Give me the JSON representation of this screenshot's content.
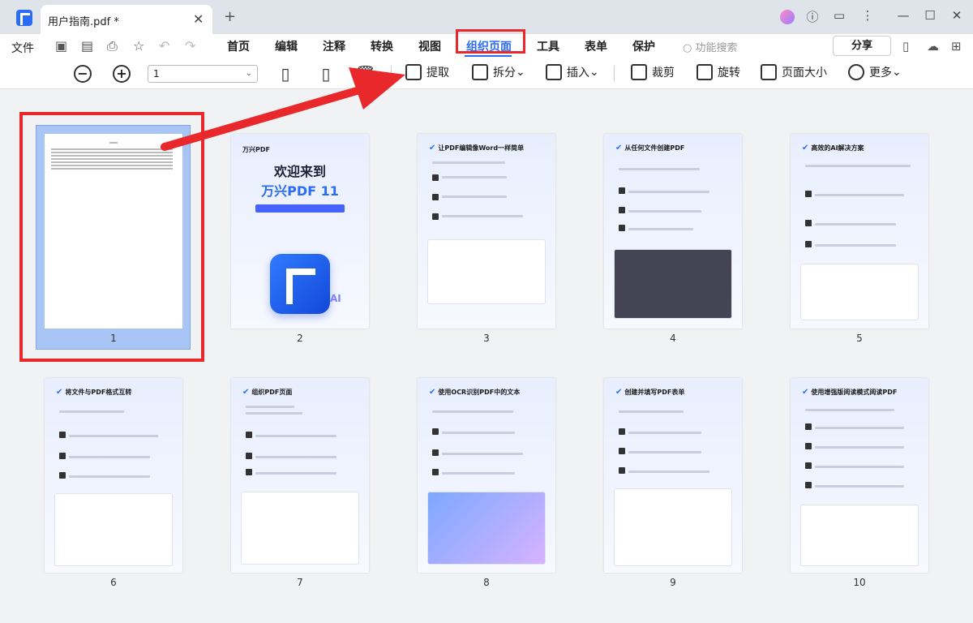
{
  "titlebar": {
    "tab_title": "用户指南.pdf *",
    "close_glyph": "✕",
    "new_tab_glyph": "+"
  },
  "menubar": {
    "file": "文件",
    "items": [
      "首页",
      "编辑",
      "注释",
      "转换",
      "视图",
      "组织页面",
      "工具",
      "表单",
      "保护"
    ],
    "active_index": 5,
    "search_placeholder": "功能搜索",
    "share": "分享"
  },
  "toolbar": {
    "page_value": "1",
    "buttons": {
      "extract": "提取",
      "split": "拆分",
      "insert": "插入",
      "crop": "裁剪",
      "rotate": "旋转",
      "page_size": "页面大小",
      "more": "更多"
    }
  },
  "pages": [
    {
      "number": "1"
    },
    {
      "number": "2",
      "brand": "万兴PDF",
      "heading1": "欢迎来到",
      "heading2": "万兴PDF 11",
      "ai": "AI"
    },
    {
      "number": "3",
      "title": "让PDF编辑像Word一样简单"
    },
    {
      "number": "4",
      "title": "从任何文件创建PDF"
    },
    {
      "number": "5",
      "title": "高效的AI解决方案"
    },
    {
      "number": "6",
      "title": "将文件与PDF格式互转"
    },
    {
      "number": "7",
      "title": "组织PDF页面"
    },
    {
      "number": "8",
      "title": "使用OCR识别PDF中的文本"
    },
    {
      "number": "9",
      "title": "创建并填写PDF表单"
    },
    {
      "number": "10",
      "title": "使用增强版阅读模式阅读PDF"
    }
  ],
  "colors": {
    "accent": "#2b6cf6",
    "highlight": "#e8282b",
    "selection": "#a9c5f5"
  }
}
